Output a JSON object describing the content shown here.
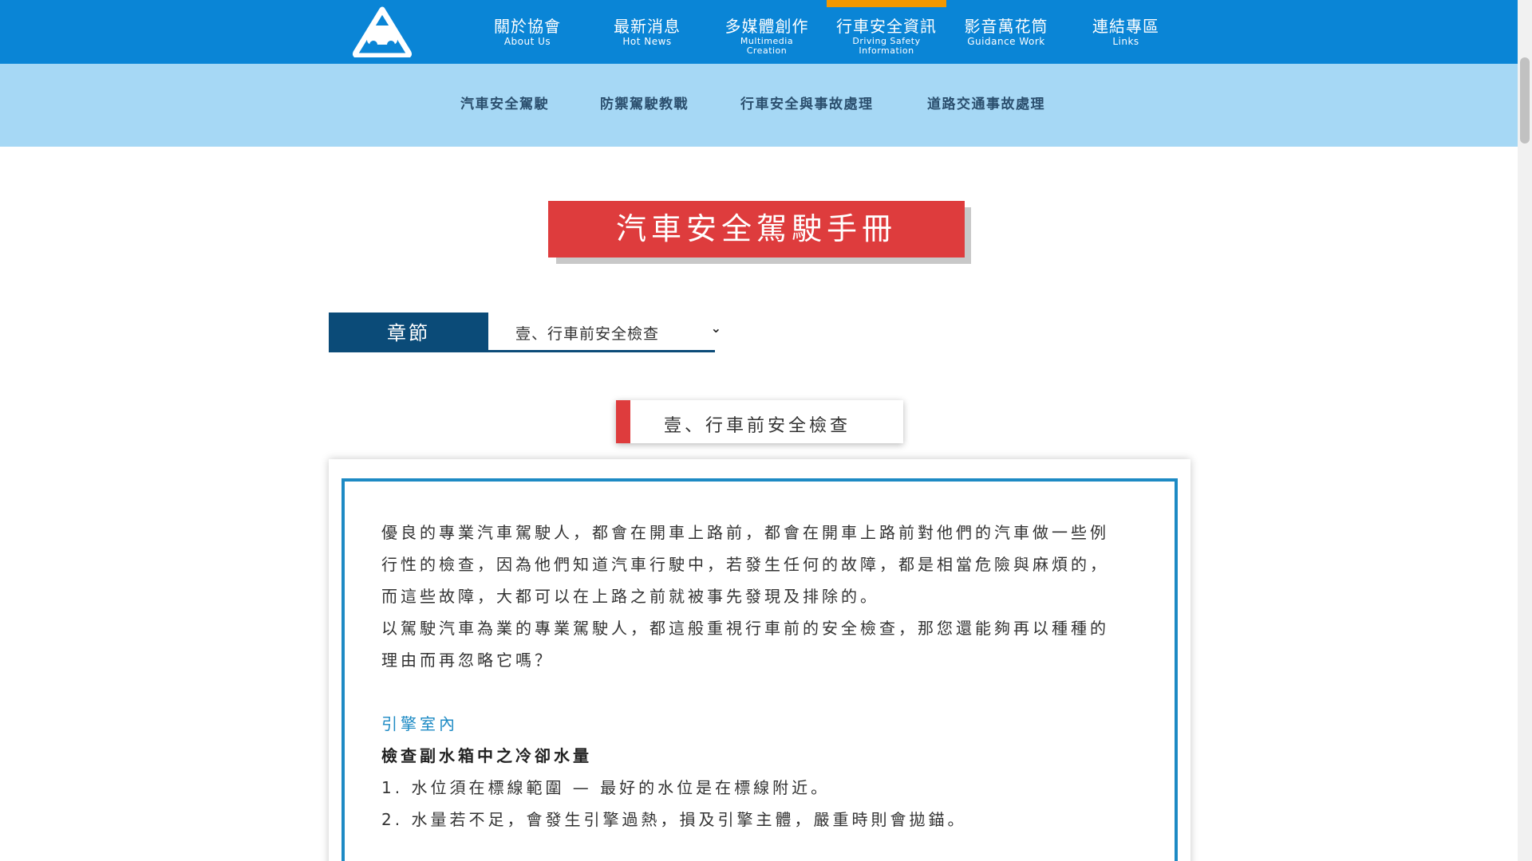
{
  "nav": {
    "items": [
      {
        "zh": "關於協會",
        "en": "About Us"
      },
      {
        "zh": "最新消息",
        "en": "Hot News"
      },
      {
        "zh": "多媒體創作",
        "en": "Multimedia Creation"
      },
      {
        "zh": "行車安全資訊",
        "en": "Driving Safety Information"
      },
      {
        "zh": "影音萬花筒",
        "en": "Guidance Work"
      },
      {
        "zh": "連結專區",
        "en": "Links"
      }
    ],
    "active_index": 3
  },
  "subnav": {
    "items": [
      "汽車安全駕駛",
      "防禦駕駛教戰",
      "行車安全與事故處理",
      "道路交通事故處理"
    ]
  },
  "banner": {
    "title": "汽車安全駕駛手冊"
  },
  "chapter": {
    "label": "章節",
    "selected": "壹、行車前安全檢查"
  },
  "section": {
    "heading": "壹、行車前安全檢查"
  },
  "content": {
    "para1": "優良的專業汽車駕駛人，都會在開車上路前，都會在開車上路前對他們的汽車做一些例行性的檢查，因為他們知道汽車行駛中，若發生任何的故障，都是相當危險與麻煩的，而這些故障，大都可以在上路之前就被事先發現及排除的。",
    "para2": "以駕駛汽車為業的專業駕駛人，都這般重視行車前的安全檢查，那您還能夠再以種種的理由而再忽略它嗎？",
    "subheading": "引擎室內",
    "bold_heading": "檢查副水箱中之冷卻水量",
    "list": [
      "1. 水位須在標線範圍 — 最好的水位是在標線附近。",
      "2. 水量若不足，會發生引擎過熱，損及引擎主體，嚴重時則會拋錨。"
    ]
  },
  "colors": {
    "nav_bg": "#0a85d6",
    "nav_active": "#f39800",
    "subnav_bg": "#a6d8f5",
    "banner_red": "#de3c3d",
    "chapter_navy": "#0b4b78",
    "accent_blue": "#1d8ac4"
  }
}
